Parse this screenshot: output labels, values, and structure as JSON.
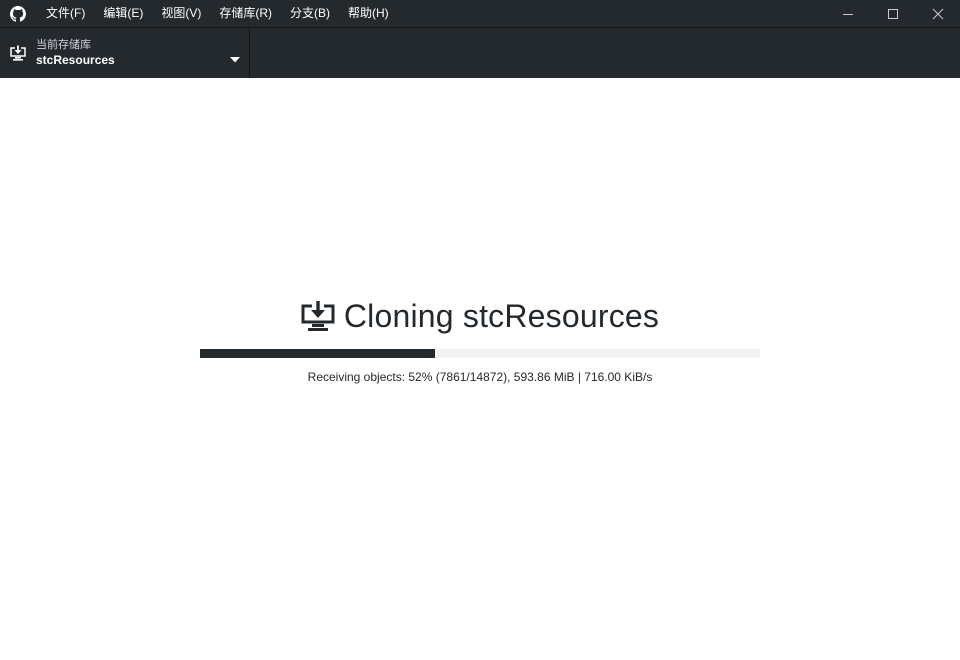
{
  "menu": {
    "items": [
      {
        "label": "文件(F)"
      },
      {
        "label": "编辑(E)"
      },
      {
        "label": "视图(V)"
      },
      {
        "label": "存储库(R)"
      },
      {
        "label": "分支(B)"
      },
      {
        "label": "帮助(H)"
      }
    ]
  },
  "window_controls": {
    "minimize_icon": "minimize-icon",
    "maximize_icon": "maximize-icon",
    "close_icon": "close-icon"
  },
  "toolbar": {
    "repository": {
      "caption": "当前存储库",
      "name": "stcResources",
      "icon": "clone-download-icon"
    }
  },
  "clone": {
    "title": "Cloning stcResources",
    "progress": 0.42,
    "detail": "Receiving objects: 52% (7861/14872), 593.86 MiB | 716.00 KiB/s"
  },
  "colors": {
    "chrome": "#24292e",
    "progress_fill": "#24292e",
    "progress_track": "#f2f2f2"
  }
}
